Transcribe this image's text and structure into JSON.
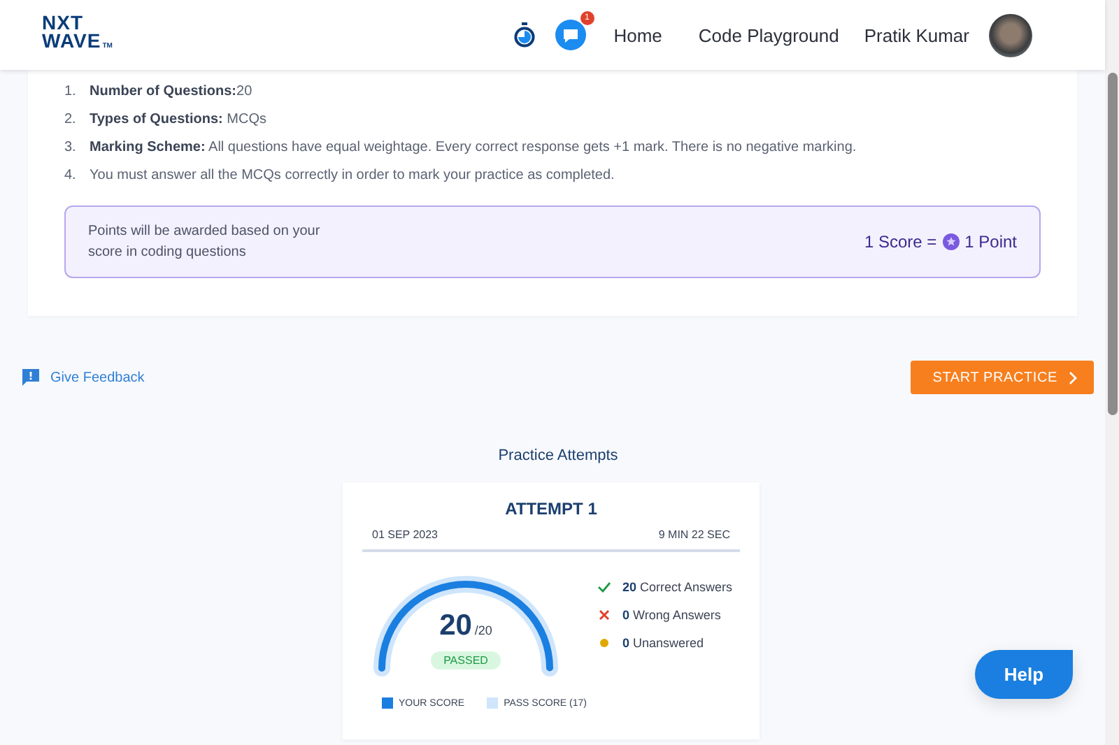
{
  "header": {
    "logo": {
      "line1": "NXT",
      "line2": "WAVE",
      "mark": "TM"
    },
    "notification_count": "1",
    "nav": [
      {
        "label": "Home"
      },
      {
        "label": "Code Playground"
      }
    ],
    "user_name": "Pratik Kumar"
  },
  "instructions": {
    "items": [
      {
        "number": "1.",
        "text": "**Number of Questions:**20"
      },
      {
        "number": "2.",
        "text": "**Types of Questions:** MCQs"
      },
      {
        "number": "3.",
        "text": "**Marking Scheme:** All questions have equal weightage. Every correct response gets +1 mark. There is no negative marking."
      },
      {
        "number": "4.",
        "text": "You must answer all the MCQs correctly in order to mark your practice as completed."
      }
    ],
    "points_note": "Points will be awarded based on your score in coding questions",
    "conversion": {
      "left": "1 Score =",
      "right": "1 Point"
    }
  },
  "feedback_link": "Give Feedback",
  "start_button": "START PRACTICE",
  "attempts_title": "Practice Attempts",
  "attempt": {
    "title": "ATTEMPT 1",
    "date": "01 SEP 2023",
    "duration": "9 MIN 22 SEC",
    "score": "20",
    "total": "/20",
    "level": 1,
    "status": "PASSED",
    "stats": [
      {
        "kind": "correct",
        "count": "20",
        "label": "Correct Answers"
      },
      {
        "kind": "wrong",
        "count": "0",
        "label": "Wrong Answers"
      },
      {
        "kind": "unanswered",
        "count": "0",
        "label": "Unanswered"
      }
    ],
    "legend": [
      {
        "kind": "your",
        "label": "YOUR SCORE"
      },
      {
        "kind": "pass",
        "label": "PASS SCORE (17)"
      }
    ]
  },
  "help_button": "Help"
}
